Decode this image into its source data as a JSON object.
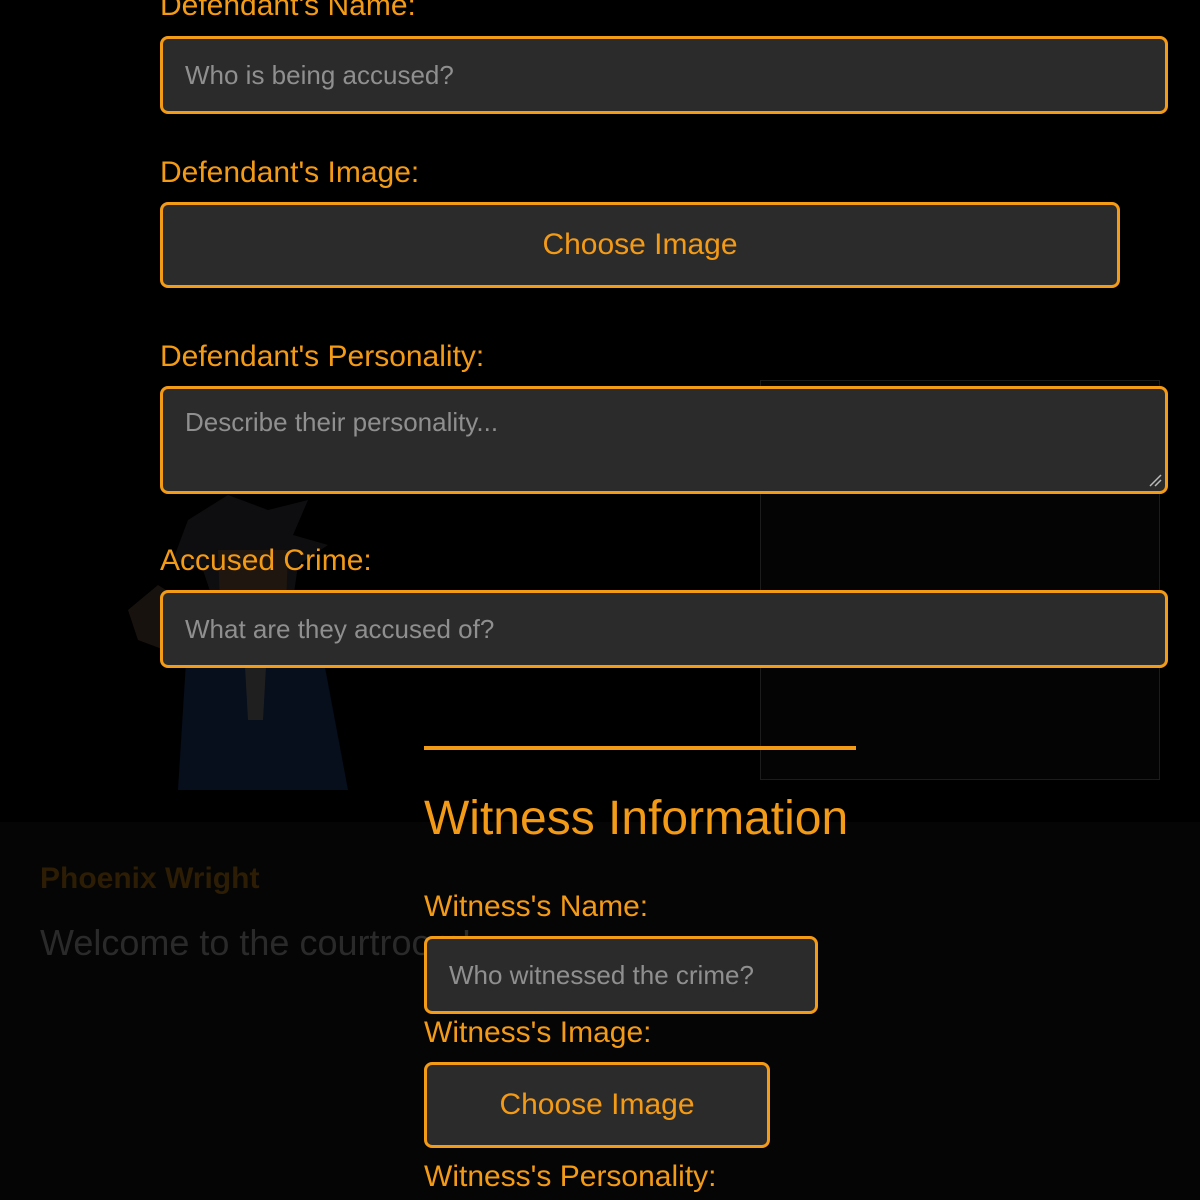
{
  "background": {
    "speaker_name": "Phoenix Wright",
    "dialog_text": "Welcome to the courtroom!"
  },
  "defendant": {
    "name_label": "Defendant's Name:",
    "name_placeholder": "Who is being accused?",
    "image_label": "Defendant's Image:",
    "image_button": "Choose Image",
    "personality_label": "Defendant's Personality:",
    "personality_placeholder": "Describe their personality...",
    "crime_label": "Accused Crime:",
    "crime_placeholder": "What are they accused of?"
  },
  "witness": {
    "section_title": "Witness Information",
    "name_label": "Witness's Name:",
    "name_placeholder": "Who witnessed the crime?",
    "image_label": "Witness's Image:",
    "image_button": "Choose Image",
    "personality_label": "Witness's Personality:"
  },
  "colors": {
    "accent": "#f39a17",
    "field_bg": "#2b2b2b",
    "page_bg": "#000000"
  }
}
